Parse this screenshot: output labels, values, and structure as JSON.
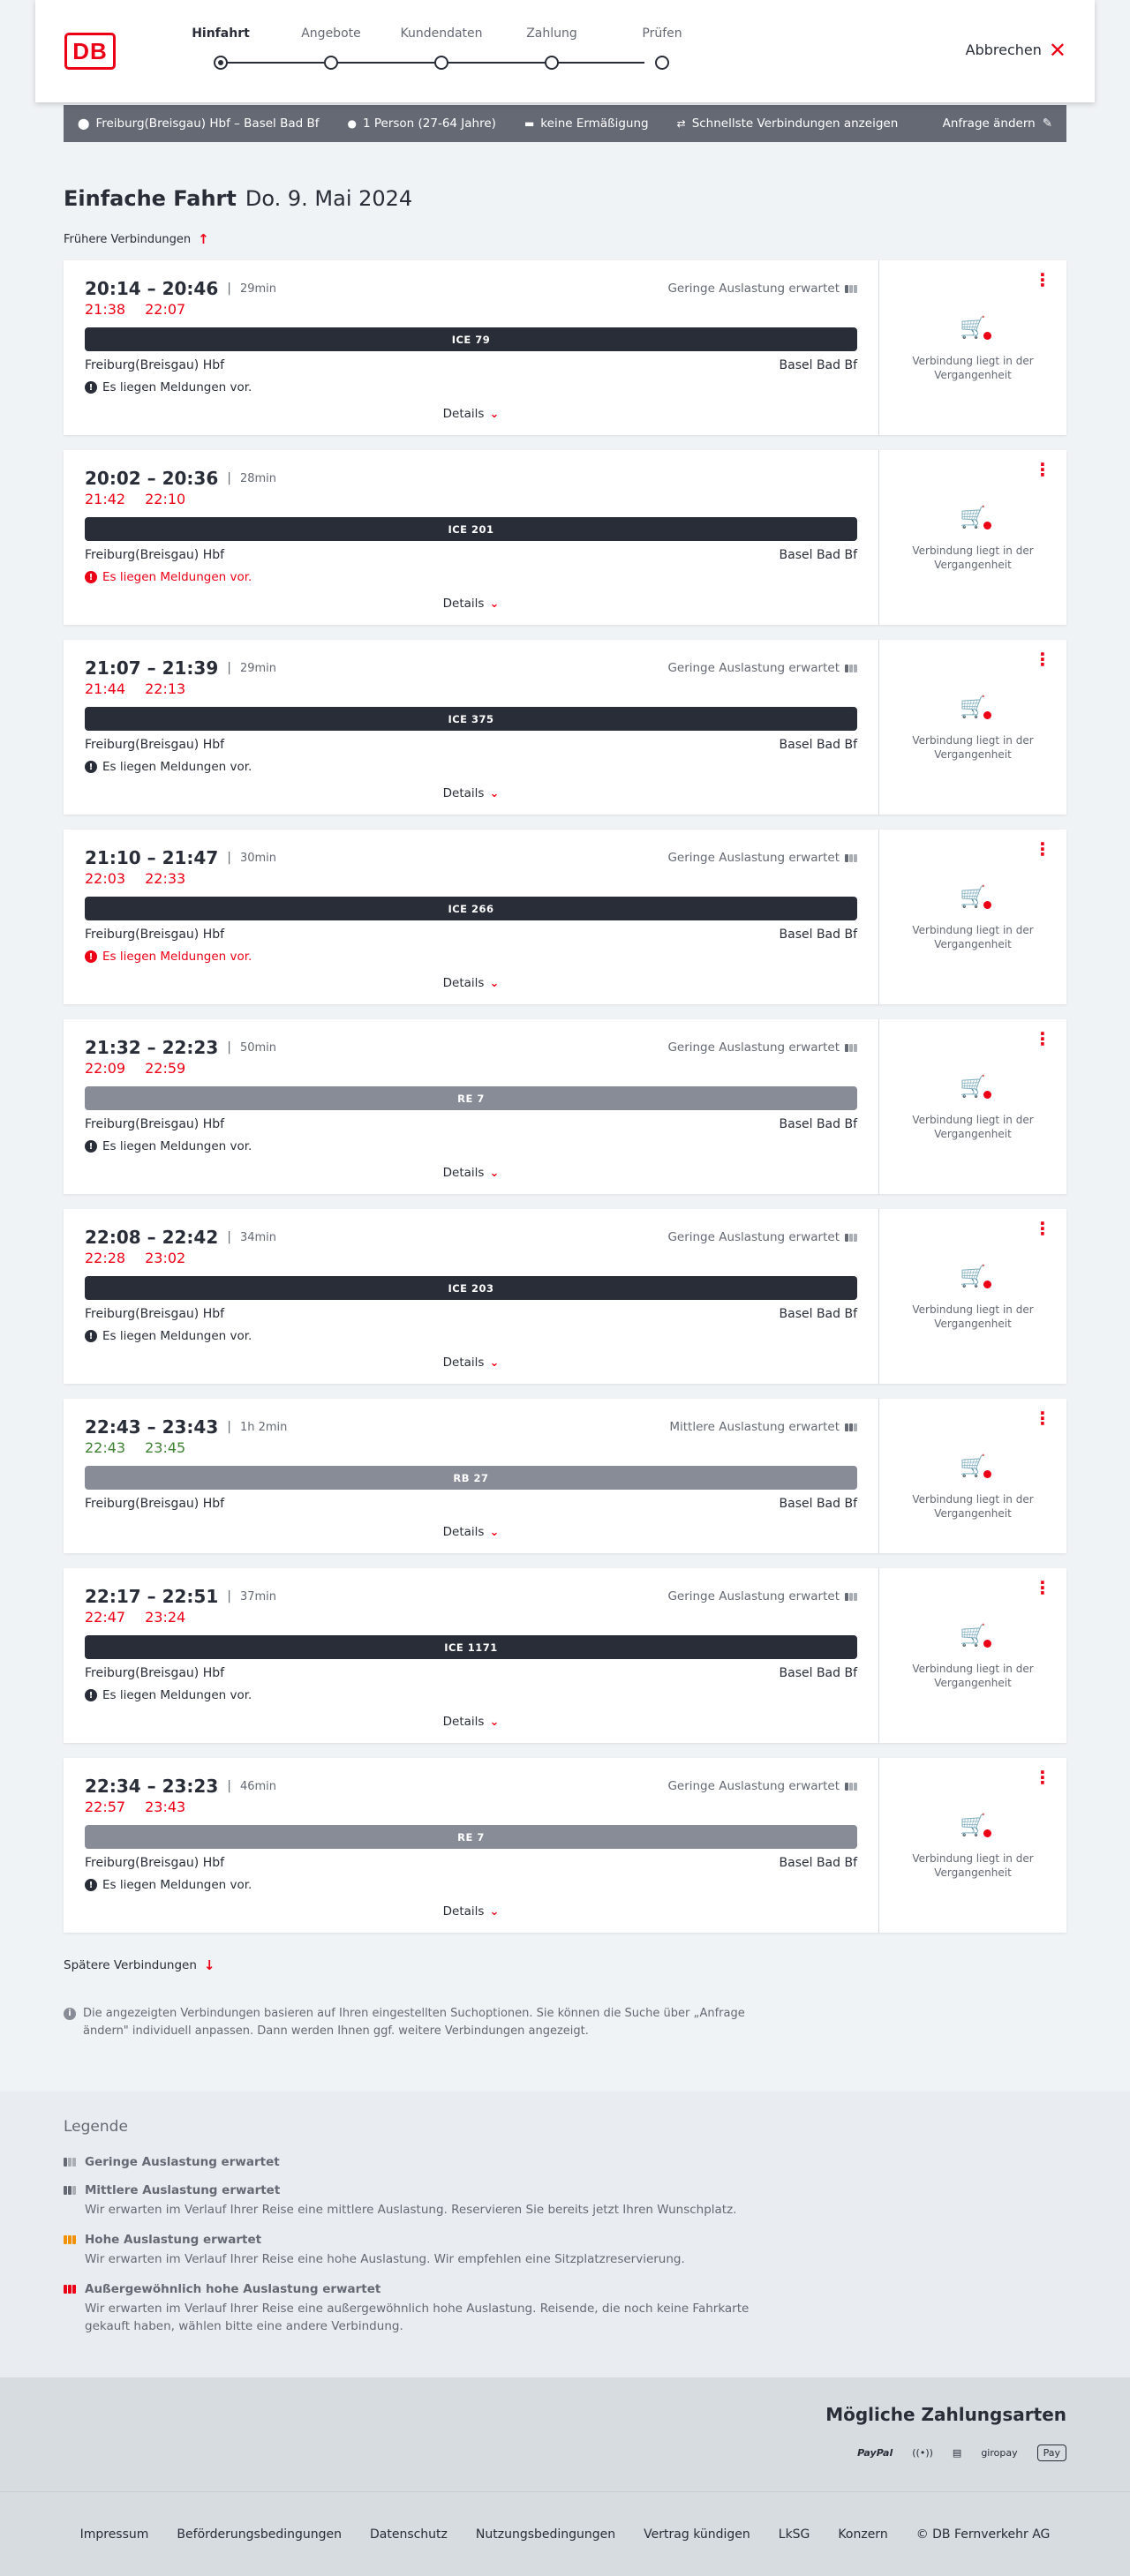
{
  "header": {
    "logo": "DB",
    "steps": [
      "Hinfahrt",
      "Angebote",
      "Kundendaten",
      "Zahlung",
      "Prüfen"
    ],
    "active_step": 0,
    "cancel_label": "Abbrechen"
  },
  "search": {
    "route": "Freiburg(Breisgau) Hbf – Basel Bad Bf",
    "passengers": "1 Person (27-64 Jahre)",
    "discount": "keine Ermäßigung",
    "fastest": "Schnellste Verbindungen anzeigen",
    "edit": "Anfrage ändern"
  },
  "trip": {
    "type": "Einfache Fahrt",
    "date": "Do. 9. Mai 2024",
    "earlier": "Frühere Verbindungen",
    "later": "Spätere Verbindungen",
    "info": "Die angezeigten Verbindungen basieren auf Ihren eingestellten Suchoptionen. Sie können die Suche über „Anfrage ändern\" individuell anpassen. Dann werden Ihnen ggf. weitere Verbindungen angezeigt."
  },
  "connections": [
    {
      "times": "20:14 – 20:46",
      "duration": "29min",
      "load": "Geringe Auslastung erwartet",
      "load_level": 1,
      "rt_dep": "21:38",
      "rt_arr": "22:07",
      "rt_color": "red",
      "train": "ICE 79",
      "train_style": "dark",
      "from": "Freiburg(Breisgau) Hbf",
      "to": "Basel Bad Bf",
      "message": "Es liegen Meldungen vor.",
      "message_alert": false
    },
    {
      "times": "20:02 – 20:36",
      "duration": "28min",
      "load": "",
      "load_level": 0,
      "rt_dep": "21:42",
      "rt_arr": "22:10",
      "rt_color": "red",
      "train": "ICE 201",
      "train_style": "dark",
      "from": "Freiburg(Breisgau) Hbf",
      "to": "Basel Bad Bf",
      "message": "Es liegen Meldungen vor.",
      "message_alert": true
    },
    {
      "times": "21:07 – 21:39",
      "duration": "29min",
      "load": "Geringe Auslastung erwartet",
      "load_level": 1,
      "rt_dep": "21:44",
      "rt_arr": "22:13",
      "rt_color": "red",
      "train": "ICE 375",
      "train_style": "dark",
      "from": "Freiburg(Breisgau) Hbf",
      "to": "Basel Bad Bf",
      "message": "Es liegen Meldungen vor.",
      "message_alert": false
    },
    {
      "times": "21:10 – 21:47",
      "duration": "30min",
      "load": "Geringe Auslastung erwartet",
      "load_level": 1,
      "rt_dep": "22:03",
      "rt_arr": "22:33",
      "rt_color": "red",
      "train": "ICE 266",
      "train_style": "dark",
      "from": "Freiburg(Breisgau) Hbf",
      "to": "Basel Bad Bf",
      "message": "Es liegen Meldungen vor.",
      "message_alert": true
    },
    {
      "times": "21:32 – 22:23",
      "duration": "50min",
      "load": "Geringe Auslastung erwartet",
      "load_level": 1,
      "rt_dep": "22:09",
      "rt_arr": "22:59",
      "rt_color": "red",
      "train": "RE 7",
      "train_style": "grey",
      "from": "Freiburg(Breisgau) Hbf",
      "to": "Basel Bad Bf",
      "message": "Es liegen Meldungen vor.",
      "message_alert": false
    },
    {
      "times": "22:08 – 22:42",
      "duration": "34min",
      "load": "Geringe Auslastung erwartet",
      "load_level": 1,
      "rt_dep": "22:28",
      "rt_arr": "23:02",
      "rt_color": "red",
      "train": "ICE 203",
      "train_style": "dark",
      "from": "Freiburg(Breisgau) Hbf",
      "to": "Basel Bad Bf",
      "message": "Es liegen Meldungen vor.",
      "message_alert": false
    },
    {
      "times": "22:43 – 23:43",
      "duration": "1h 2min",
      "load": "Mittlere Auslastung erwartet",
      "load_level": 2,
      "rt_dep": "22:43",
      "rt_arr": "23:45",
      "rt_color": "green",
      "train": "RB 27",
      "train_style": "grey",
      "from": "Freiburg(Breisgau) Hbf",
      "to": "Basel Bad Bf",
      "message": "",
      "message_alert": false
    },
    {
      "times": "22:17 – 22:51",
      "duration": "37min",
      "load": "Geringe Auslastung erwartet",
      "load_level": 1,
      "rt_dep": "22:47",
      "rt_arr": "23:24",
      "rt_color": "red",
      "train": "ICE 1171",
      "train_style": "dark",
      "from": "Freiburg(Breisgau) Hbf",
      "to": "Basel Bad Bf",
      "message": "Es liegen Meldungen vor.",
      "message_alert": false
    },
    {
      "times": "22:34 – 23:23",
      "duration": "46min",
      "load": "Geringe Auslastung erwartet",
      "load_level": 1,
      "rt_dep": "22:57",
      "rt_arr": "23:43",
      "rt_color": "red",
      "train": "RE 7",
      "train_style": "grey",
      "from": "Freiburg(Breisgau) Hbf",
      "to": "Basel Bad Bf",
      "message": "Es liegen Meldungen vor.",
      "message_alert": false
    }
  ],
  "card_labels": {
    "details": "Details",
    "past": "Verbindung liegt in der Vergangenheit"
  },
  "legend": {
    "title": "Legende",
    "items": [
      {
        "title": "Geringe Auslastung erwartet",
        "desc": "",
        "level": 1,
        "style": "grey"
      },
      {
        "title": "Mittlere Auslastung erwartet",
        "desc": "Wir erwarten im Verlauf Ihrer Reise eine mittlere Auslastung. Reservieren Sie bereits jetzt Ihren Wunschplatz.",
        "level": 2,
        "style": "grey"
      },
      {
        "title": "Hohe Auslastung erwartet",
        "desc": "Wir erwarten im Verlauf Ihrer Reise eine hohe Auslastung. Wir empfehlen eine Sitzplatzreservierung.",
        "level": 3,
        "style": "orange"
      },
      {
        "title": "Außergewöhnlich hohe Auslastung erwartet",
        "desc": "Wir erwarten im Verlauf Ihrer Reise eine außergewöhnlich hohe Auslastung. Reisende, die noch keine Fahrkarte gekauft haben, wählen bitte eine andere Verbindung.",
        "level": 3,
        "style": "red"
      }
    ]
  },
  "payment": {
    "title": "Mögliche Zahlungsarten",
    "methods": [
      "PayPal",
      "giropay",
      "Pay"
    ]
  },
  "footer": {
    "links": [
      "Impressum",
      "Beförderungsbedingungen",
      "Datenschutz",
      "Nutzungsbedingungen",
      "Vertrag kündigen",
      "LkSG",
      "Konzern",
      "© DB Fernverkehr AG"
    ]
  },
  "colors": {
    "db_red": "#ec0016",
    "dark": "#282d37",
    "grey_train": "#878c96",
    "green": "#408335"
  }
}
